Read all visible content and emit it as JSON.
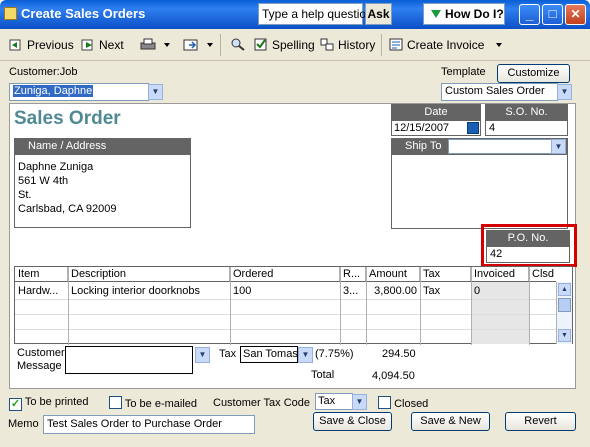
{
  "window": {
    "title": "Create Sales Orders"
  },
  "help": {
    "placeholder": "Type a help question",
    "ask_label": "Ask",
    "howdo_label": "How Do I?"
  },
  "window_controls": {
    "minimize": "_",
    "maximize": "□",
    "close": "✕"
  },
  "toolbar": {
    "previous": "Previous",
    "next": "Next",
    "spelling": "Spelling",
    "history": "History",
    "create_invoice": "Create Invoice"
  },
  "form": {
    "customer_job_label": "Customer:Job",
    "customer_job_value": "Zuniga, Daphne",
    "template_label": "Template",
    "customize_label": "Customize",
    "template_value": "Custom Sales Order",
    "doc_title": "Sales Order",
    "date_label": "Date",
    "date_value": "12/15/2007",
    "so_label": "S.O. No.",
    "so_value": "4",
    "name_address_label": "Name / Address",
    "address_lines": [
      "Daphne Zuniga",
      "561 W 4th",
      "St.",
      "Carlsbad, CA 92009"
    ],
    "ship_to_label": "Ship To",
    "ship_to_value": "",
    "po_label": "P.O. No.",
    "po_value": "42"
  },
  "table": {
    "columns": [
      "Item",
      "Description",
      "Ordered",
      "R...",
      "Amount",
      "Tax",
      "Invoiced",
      "Clsd"
    ],
    "rows": [
      {
        "item": "Hardw...",
        "description": "Locking interior doorknobs",
        "ordered": "100",
        "rate": "3...",
        "amount": "3,800.00",
        "tax": "Tax",
        "invoiced": "0",
        "clsd": ""
      }
    ]
  },
  "footer": {
    "customer_message_label": "Customer Message",
    "customer_message_value": "",
    "tax_label": "Tax",
    "tax_item_value": "San Tomas",
    "tax_rate": "(7.75%)",
    "tax_amount": "294.50",
    "total_label": "Total",
    "total_value": "4,094.50",
    "to_be_printed_label": "To be printed",
    "to_be_printed_checked": true,
    "to_be_emailed_label": "To be e-mailed",
    "to_be_emailed_checked": false,
    "customer_tax_code_label": "Customer Tax Code",
    "customer_tax_code_value": "Tax",
    "closed_label": "Closed",
    "closed_checked": false,
    "memo_label": "Memo",
    "memo_value": "Test Sales Order to Purchase Order",
    "save_close_label": "Save & Close",
    "save_new_label": "Save & New",
    "revert_label": "Revert"
  },
  "colors": {
    "title_bar": "#0a5fd6",
    "highlight": "#d40000",
    "sales_title": "#4f8a94",
    "panel": "#ece9d8",
    "header_bg": "#646464"
  },
  "icons": [
    "window-icon",
    "previous-icon",
    "next-icon",
    "print-icon",
    "email-icon",
    "find-icon",
    "spelling-icon",
    "history-icon",
    "create-invoice-icon",
    "calendar-icon",
    "dropdown-arrow-icon",
    "checkmark-icon"
  ]
}
